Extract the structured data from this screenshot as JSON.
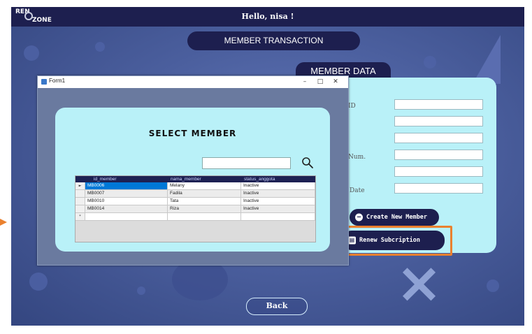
{
  "topbar": {
    "logo_top": "REN",
    "logo_bottom": "ZONE",
    "greeting": "Hello, nisa !"
  },
  "page_title": "MEMBER TRANSACTION",
  "member_data": {
    "title": "MEMBER DATA",
    "labels": [
      "ID",
      "",
      "",
      "Num.",
      "",
      "Date"
    ],
    "create_button": "Create New Member",
    "renew_button": "Renew Subcription"
  },
  "back_button": "Back",
  "form1": {
    "title": "Form1",
    "controls": {
      "minimize": "–",
      "maximize": "□",
      "close": "✕"
    },
    "heading": "SELECT MEMBER",
    "search_placeholder": "",
    "grid": {
      "columns": [
        "id_member",
        "nama_member",
        "status_anggota"
      ],
      "rows": [
        [
          "MB0006",
          "Melany",
          "Inactive"
        ],
        [
          "MB0007",
          "Fadila",
          "Inactive"
        ],
        [
          "MB0010",
          "Tata",
          "Inactive"
        ],
        [
          "MB0014",
          "Riza",
          "Inactive"
        ]
      ],
      "row_pointer": "►",
      "new_row_marker": "*"
    }
  },
  "colors": {
    "navy": "#1d1f4f",
    "panel": "#b9f1f8",
    "highlight": "#ea812f",
    "selected_cell": "#0078d7"
  },
  "icons": {
    "search": "search-icon",
    "create": "user-add-icon",
    "renew": "renew-icon"
  }
}
